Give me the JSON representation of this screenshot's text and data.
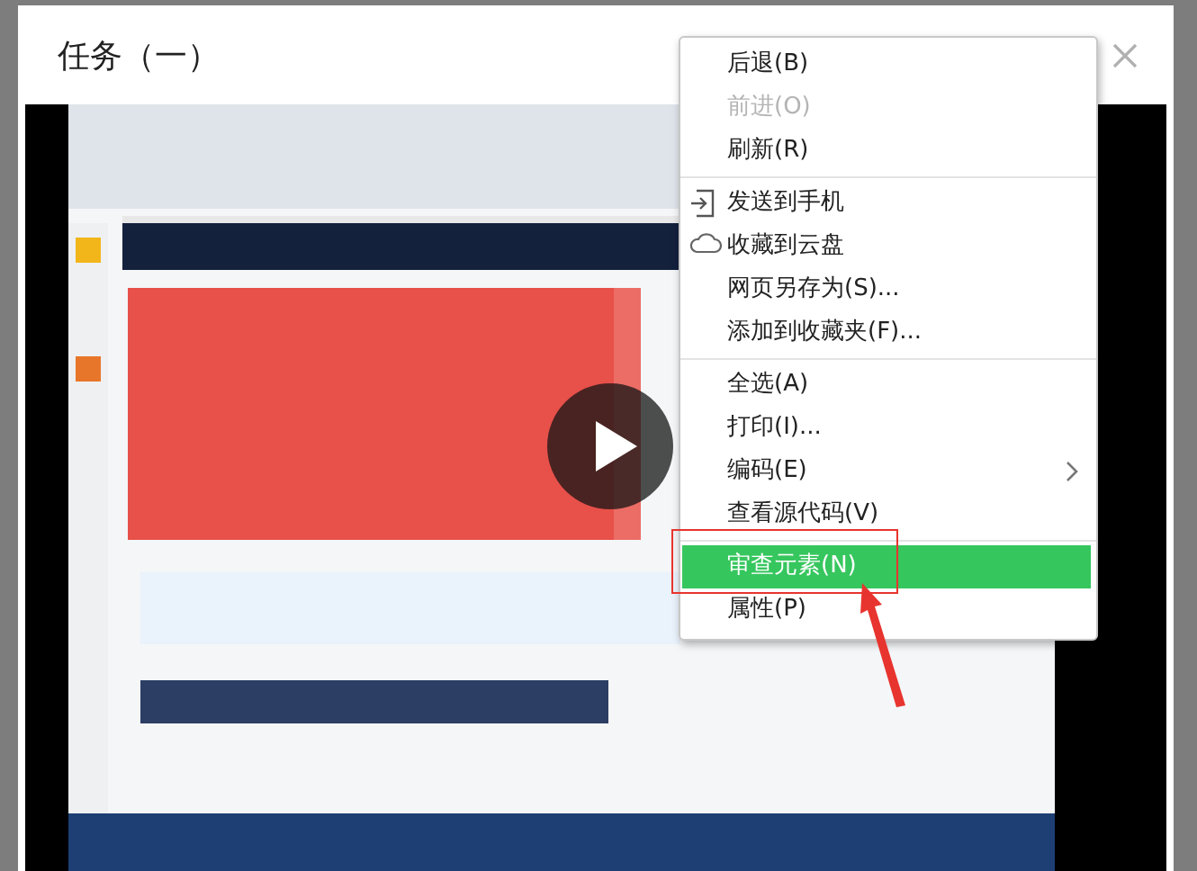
{
  "dialog": {
    "title": "任务（一）"
  },
  "context_menu": {
    "items": [
      {
        "kind": "item",
        "label": "后退(B)",
        "disabled": false,
        "selected": false,
        "submenu": false
      },
      {
        "kind": "item",
        "label": "前进(O)",
        "disabled": true,
        "selected": false,
        "submenu": false
      },
      {
        "kind": "item",
        "label": "刷新(R)",
        "disabled": false,
        "selected": false,
        "submenu": false
      },
      {
        "kind": "separator"
      },
      {
        "kind": "item",
        "label": "发送到手机",
        "disabled": false,
        "selected": false,
        "submenu": false
      },
      {
        "kind": "item",
        "label": "收藏到云盘",
        "disabled": false,
        "selected": false,
        "submenu": false
      },
      {
        "kind": "item",
        "label": "网页另存为(S)...",
        "disabled": false,
        "selected": false,
        "submenu": false
      },
      {
        "kind": "item",
        "label": "添加到收藏夹(F)...",
        "disabled": false,
        "selected": false,
        "submenu": false
      },
      {
        "kind": "separator"
      },
      {
        "kind": "item",
        "label": "全选(A)",
        "disabled": false,
        "selected": false,
        "submenu": false
      },
      {
        "kind": "item",
        "label": "打印(I)...",
        "disabled": false,
        "selected": false,
        "submenu": false
      },
      {
        "kind": "item",
        "label": "编码(E)",
        "disabled": false,
        "selected": false,
        "submenu": true
      },
      {
        "kind": "item",
        "label": "查看源代码(V)",
        "disabled": false,
        "selected": false,
        "submenu": false
      },
      {
        "kind": "separator"
      },
      {
        "kind": "item",
        "label": "审查元素(N)",
        "disabled": false,
        "selected": true,
        "submenu": false
      },
      {
        "kind": "item",
        "label": "属性(P)",
        "disabled": false,
        "selected": false,
        "submenu": false
      }
    ]
  }
}
